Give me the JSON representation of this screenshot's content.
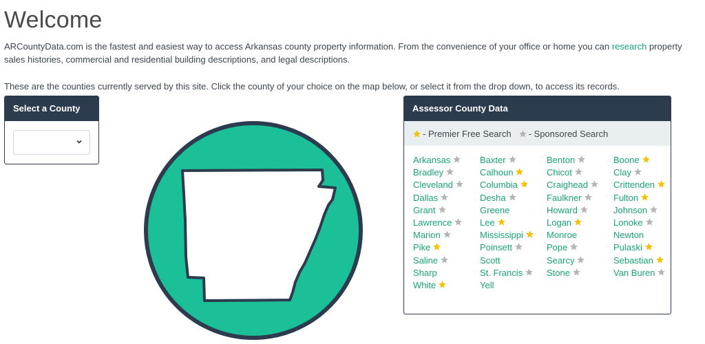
{
  "page": {
    "title": "Welcome",
    "intro_before_link": "ARCountyData.com is the fastest and easiest way to access Arkansas county property information. From the convenience of your office or home you can ",
    "intro_link": "research",
    "intro_after_link": " property sales histories, commercial and residential building descriptions, and legal descriptions.",
    "instruction": "These are the counties currently served by this site. Click the county of your choice on the map below, or select it from the drop down, to access its records."
  },
  "select_panel": {
    "header": "Select a County",
    "selected_value": ""
  },
  "data_panel": {
    "header": "Assessor County Data",
    "legend": [
      {
        "label": "- Premier Free Search",
        "star": "gold"
      },
      {
        "label": "- Sponsored Search",
        "star": "gray"
      }
    ]
  },
  "colors": {
    "accent": "#1aa37a",
    "header_bg": "#2c3b4d",
    "map_fill": "#1bbf98",
    "star_gold": "#f2c200",
    "star_gray": "#b5b5b5"
  },
  "counties": [
    {
      "name": "Arkansas",
      "star": "gray"
    },
    {
      "name": "Baxter",
      "star": "gray"
    },
    {
      "name": "Benton",
      "star": "gray"
    },
    {
      "name": "Boone",
      "star": "gold"
    },
    {
      "name": "Bradley",
      "star": "gray"
    },
    {
      "name": "Calhoun",
      "star": "gold"
    },
    {
      "name": "Chicot",
      "star": "gray"
    },
    {
      "name": "Clay",
      "star": "gray"
    },
    {
      "name": "Cleveland",
      "star": "gray"
    },
    {
      "name": "Columbia",
      "star": "gold"
    },
    {
      "name": "Craighead",
      "star": "gray"
    },
    {
      "name": "Crittenden",
      "star": "gold"
    },
    {
      "name": "Dallas",
      "star": "gray"
    },
    {
      "name": "Desha",
      "star": "gray"
    },
    {
      "name": "Faulkner",
      "star": "gray"
    },
    {
      "name": "Fulton",
      "star": "gold"
    },
    {
      "name": "Grant",
      "star": "gray"
    },
    {
      "name": "Greene",
      "star": "none"
    },
    {
      "name": "Howard",
      "star": "gray"
    },
    {
      "name": "Johnson",
      "star": "gray"
    },
    {
      "name": "Lawrence",
      "star": "gray"
    },
    {
      "name": "Lee",
      "star": "gold"
    },
    {
      "name": "Logan",
      "star": "gold"
    },
    {
      "name": "Lonoke",
      "star": "gray"
    },
    {
      "name": "Marion",
      "star": "gray"
    },
    {
      "name": "Mississippi",
      "star": "gold"
    },
    {
      "name": "Monroe",
      "star": "none"
    },
    {
      "name": "Newton",
      "star": "none"
    },
    {
      "name": "Pike",
      "star": "gold"
    },
    {
      "name": "Poinsett",
      "star": "gray"
    },
    {
      "name": "Pope",
      "star": "gray"
    },
    {
      "name": "Pulaski",
      "star": "gold"
    },
    {
      "name": "Saline",
      "star": "gray"
    },
    {
      "name": "Scott",
      "star": "none"
    },
    {
      "name": "Searcy",
      "star": "gray"
    },
    {
      "name": "Sebastian",
      "star": "gold"
    },
    {
      "name": "Sharp",
      "star": "none"
    },
    {
      "name": "St. Francis",
      "star": "gray"
    },
    {
      "name": "Stone",
      "star": "gray"
    },
    {
      "name": "Van Buren",
      "star": "gray"
    },
    {
      "name": "White",
      "star": "gold"
    },
    {
      "name": "Yell",
      "star": "none"
    }
  ]
}
